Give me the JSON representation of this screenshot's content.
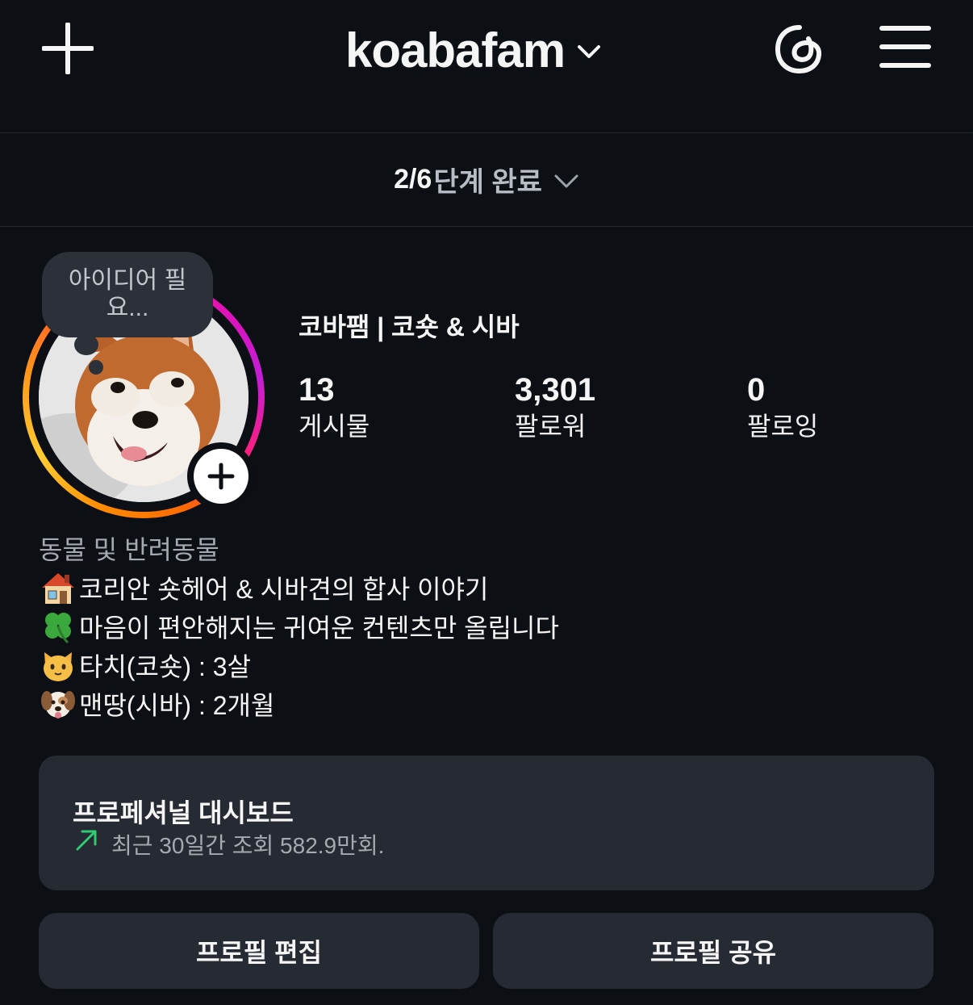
{
  "header": {
    "username": "koabafam"
  },
  "steps": {
    "count": "2/6",
    "label": "단계 완료"
  },
  "note": {
    "text": "아이디어 필요..."
  },
  "profile": {
    "display_name": "코바팸 | 코숏 & 시바",
    "stats": [
      {
        "value": "13",
        "label": "게시물"
      },
      {
        "value": "3,301",
        "label": "팔로워"
      },
      {
        "value": "0",
        "label": "팔로잉"
      }
    ],
    "category": "동물 및 반려동물",
    "bio": [
      {
        "icon": "house-emoji-icon",
        "text": "코리안 숏헤어 & 시바견의 합사 이야기"
      },
      {
        "icon": "four-leaf-clover-emoji-icon",
        "text": "마음이 편안해지는 귀여운 컨텐츠만 올립니다"
      },
      {
        "icon": "cat-face-emoji-icon",
        "text": "타치(코숏) : 3살"
      },
      {
        "icon": "dog-face-emoji-icon",
        "text": "맨땅(시바) : 2개월"
      }
    ]
  },
  "dashboard": {
    "title": "프로페셔널 대시보드",
    "subtitle": "최근 30일간 조회 582.9만회.",
    "accent": "#2ecc71"
  },
  "buttons": {
    "edit_profile": "프로필 편집",
    "share_profile": "프로필 공유"
  },
  "colors": {
    "background": "#0c0f14",
    "card": "#262a32",
    "secondary_text": "#a5a9b0"
  }
}
